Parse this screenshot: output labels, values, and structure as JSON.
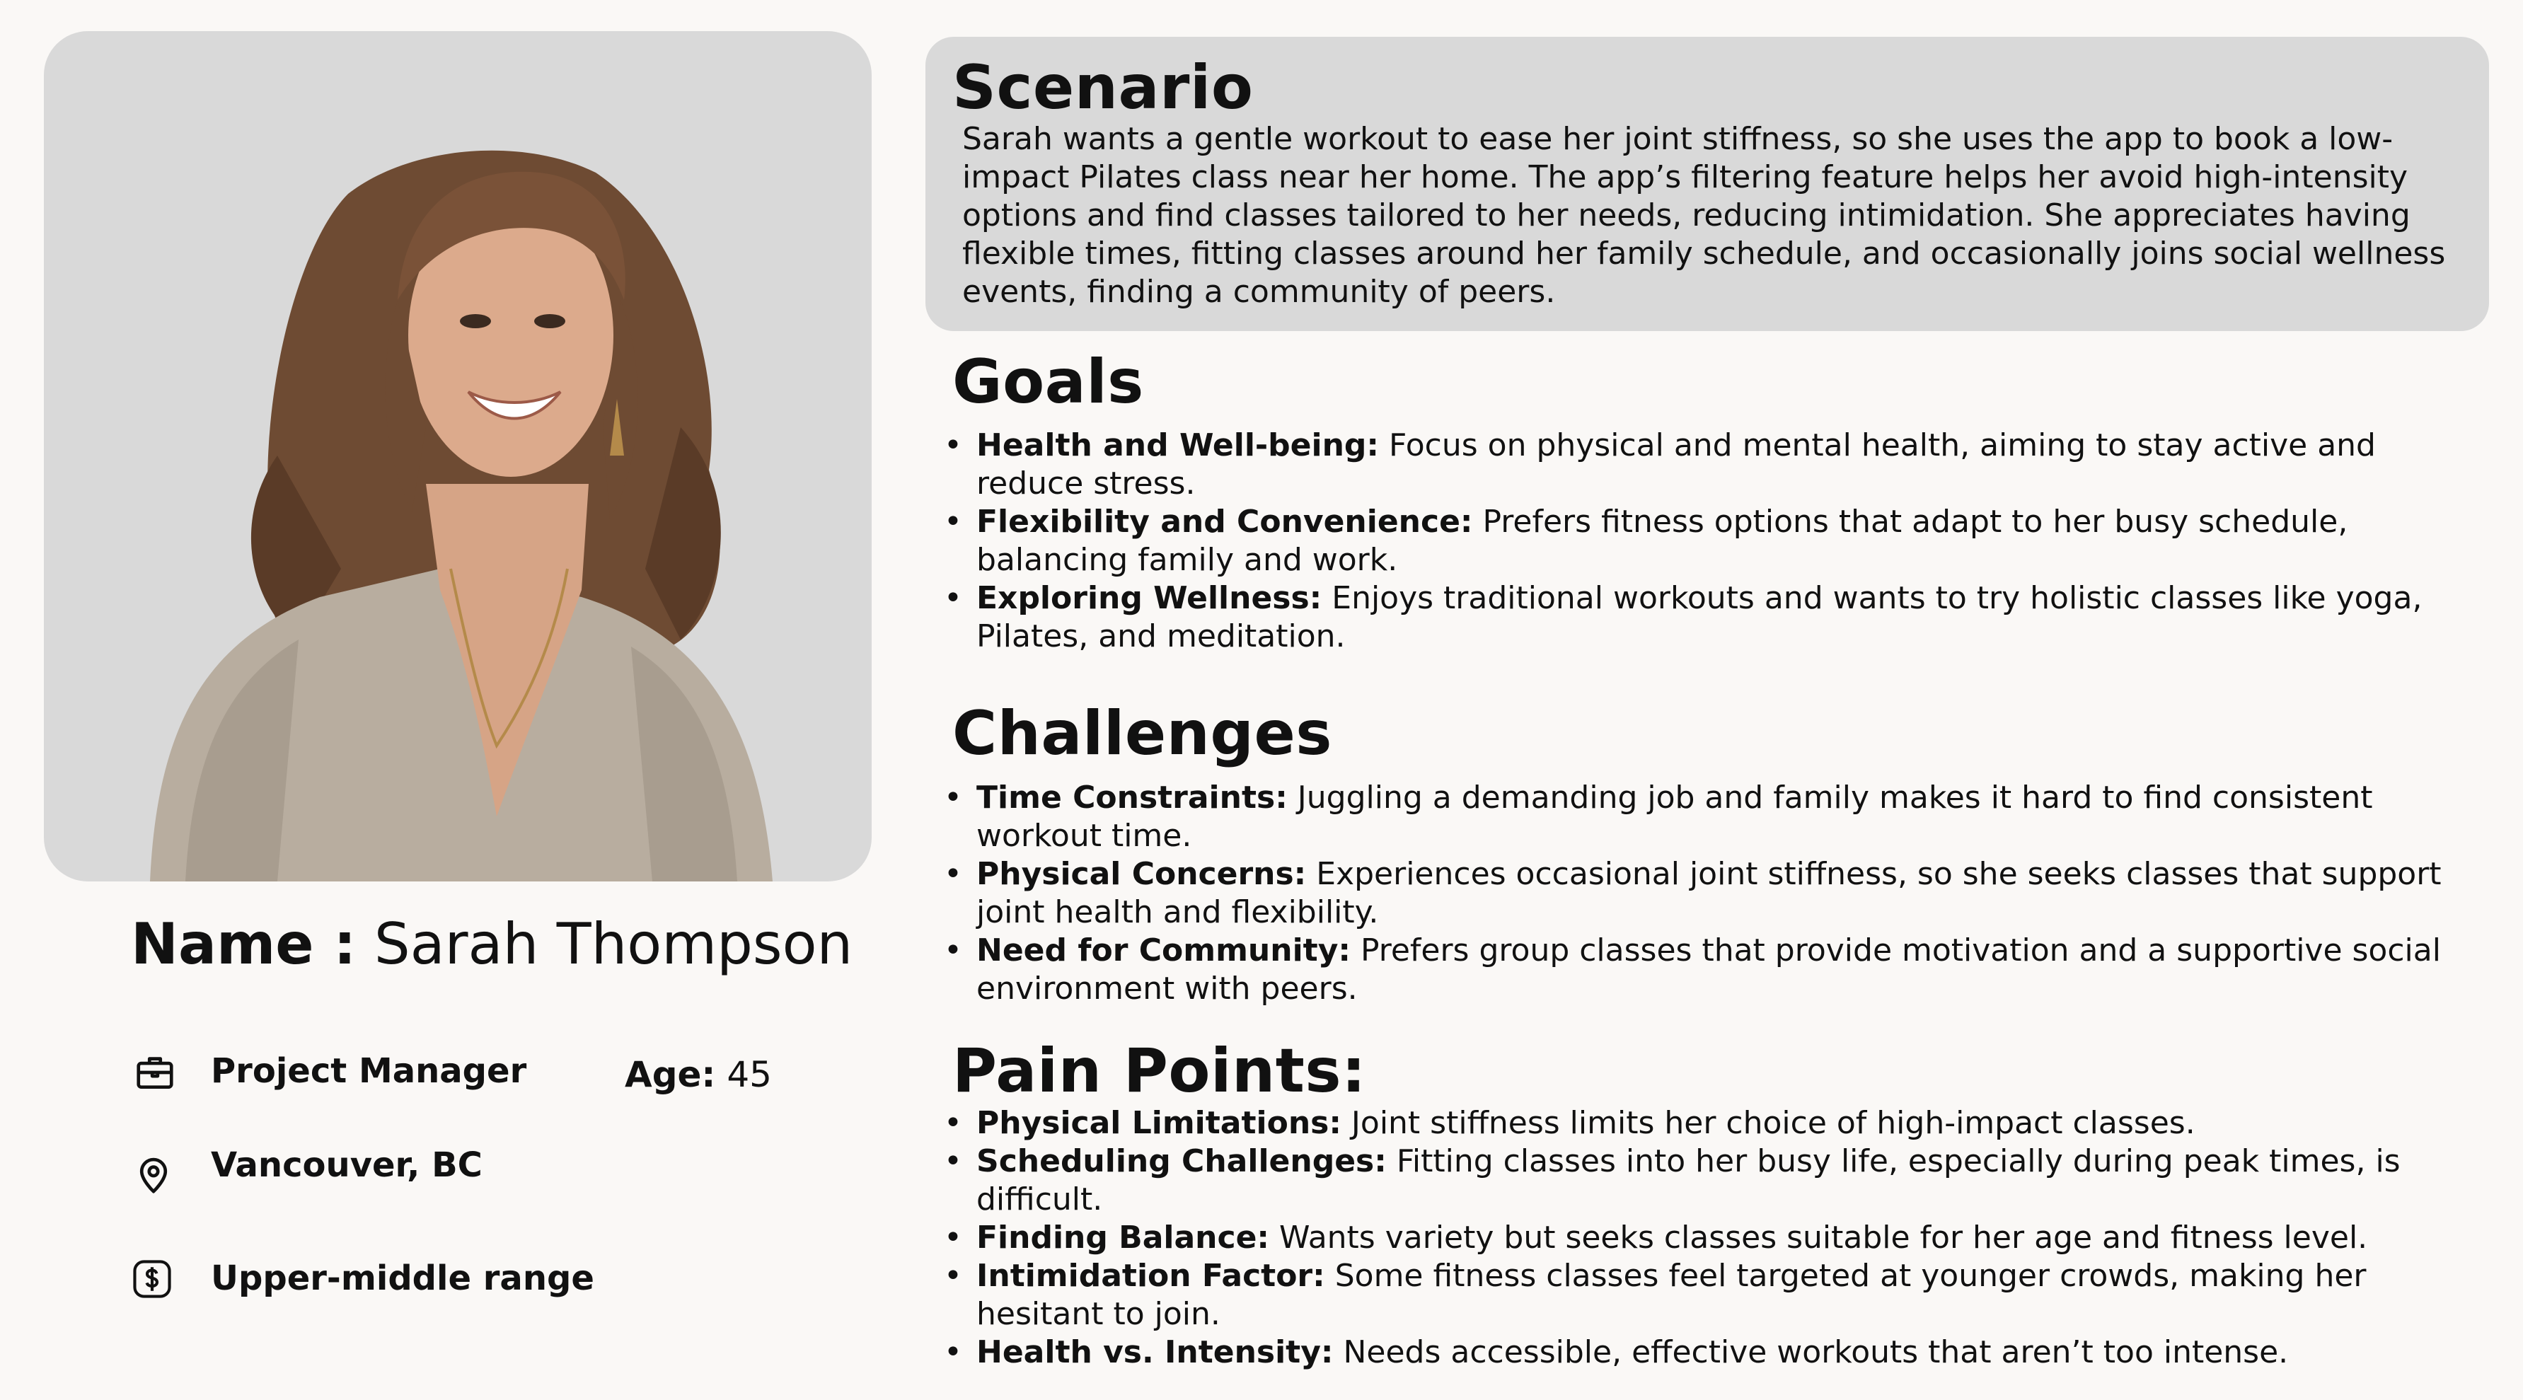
{
  "persona": {
    "photo_alt": "Portrait of Sarah Thompson",
    "name_label": "Name :",
    "name_value": "Sarah Thompson",
    "occupation": "Project Manager",
    "location": "Vancouver, BC",
    "income": "Upper-middle range",
    "age_label": "Age:",
    "age_value": "45",
    "icons": [
      "briefcase-icon",
      "location-pin-icon",
      "dollar-icon"
    ]
  },
  "scenario": {
    "title": "Scenario",
    "text": "Sarah wants a gentle workout to ease her joint stiffness, so she uses the app to book a low-impact Pilates class near her home. The app’s filtering feature helps her avoid high-intensity options and find classes tailored to her needs, reducing intimidation. She appreciates having flexible times, fitting classes around her family schedule, and occasionally joins social wellness events, finding a community of peers."
  },
  "goals": {
    "title": "Goals",
    "items": [
      {
        "label": "Health and Well-being:",
        "text": " Focus on physical and mental health, aiming to stay active and reduce stress."
      },
      {
        "label": "Flexibility and Convenience:",
        "text": " Prefers fitness options that adapt to her busy schedule, balancing family and work."
      },
      {
        "label": "Exploring Wellness:",
        "text": " Enjoys traditional workouts and wants to try holistic classes like yoga, Pilates, and meditation."
      }
    ]
  },
  "challenges": {
    "title": "Challenges",
    "items": [
      {
        "label": "Time Constraints:",
        "text": " Juggling a demanding job and family makes it hard to find consistent workout time."
      },
      {
        "label": "Physical Concerns:",
        "text": " Experiences occasional joint stiffness, so she seeks classes that support joint health and flexibility."
      },
      {
        "label": "Need for Community:",
        "text": " Prefers group classes that provide motivation and a supportive social environment with peers."
      }
    ]
  },
  "pain_points": {
    "title": "Pain Points:",
    "items": [
      {
        "label": "Physical Limitations:",
        "text": " Joint stiffness limits her choice of high-impact classes."
      },
      {
        "label": "Scheduling Challenges:",
        "text": " Fitting classes into her busy life, especially during peak times, is difficult."
      },
      {
        "label": "Finding Balance:",
        "text": " Wants variety but seeks classes suitable for her age and fitness level."
      },
      {
        "label": "Intimidation Factor:",
        "text": " Some fitness classes feel targeted at younger crowds, making her hesitant to join."
      },
      {
        "label": "Health vs. Intensity:",
        "text": " Needs accessible, effective workouts that aren’t too intense."
      }
    ]
  }
}
